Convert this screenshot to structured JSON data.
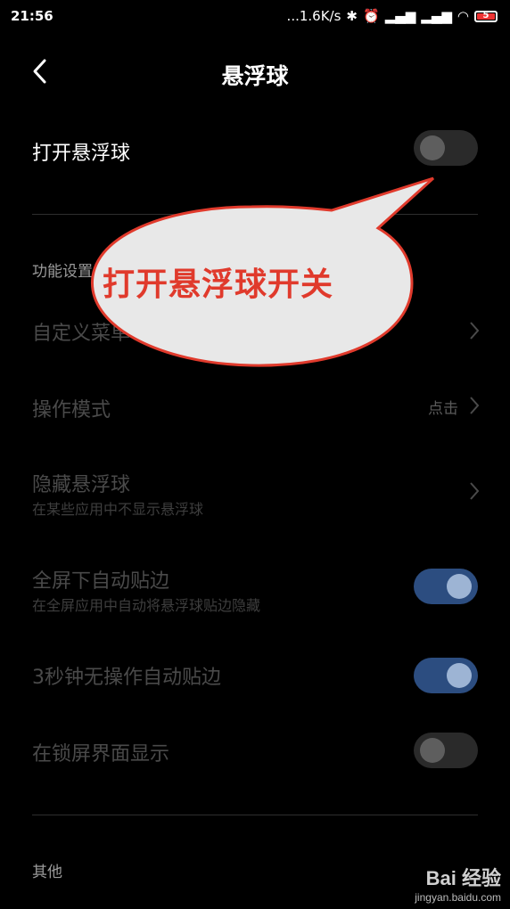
{
  "status_bar": {
    "time": "21:56",
    "net_speed": "...1.6K/s",
    "icons": [
      "bluetooth-icon",
      "alarm-icon",
      "signal-icon",
      "hd-signal-icon",
      "wifi-icon",
      "battery-icon"
    ],
    "battery": "5",
    "battery_color": "#e33333"
  },
  "header": {
    "title": "悬浮球"
  },
  "main_toggle": {
    "label": "打开悬浮球",
    "state": "off"
  },
  "function_section": {
    "title": "功能设置"
  },
  "items": [
    {
      "label": "自定义菜单"
    },
    {
      "label": "操作模式",
      "value": "点击"
    },
    {
      "label": "隐藏悬浮球",
      "sub": "在某些应用中不显示悬浮球"
    },
    {
      "label": "全屏下自动贴边",
      "sub": "在全屏应用中自动将悬浮球贴边隐藏",
      "state": "on"
    },
    {
      "label": "3秒钟无操作自动贴边",
      "state": "on"
    },
    {
      "label": "在锁屏界面显示",
      "state": "off"
    }
  ],
  "other_section": {
    "title": "其他"
  },
  "annotation": {
    "text": "打开悬浮球开关",
    "color": "#e03a2c"
  },
  "watermark": {
    "logo": "Bai 经验",
    "url": "jingyan.baidu.com"
  },
  "colors": {
    "toggle_on": "#2c4d80",
    "toggle_off": "#2a2a2a"
  }
}
